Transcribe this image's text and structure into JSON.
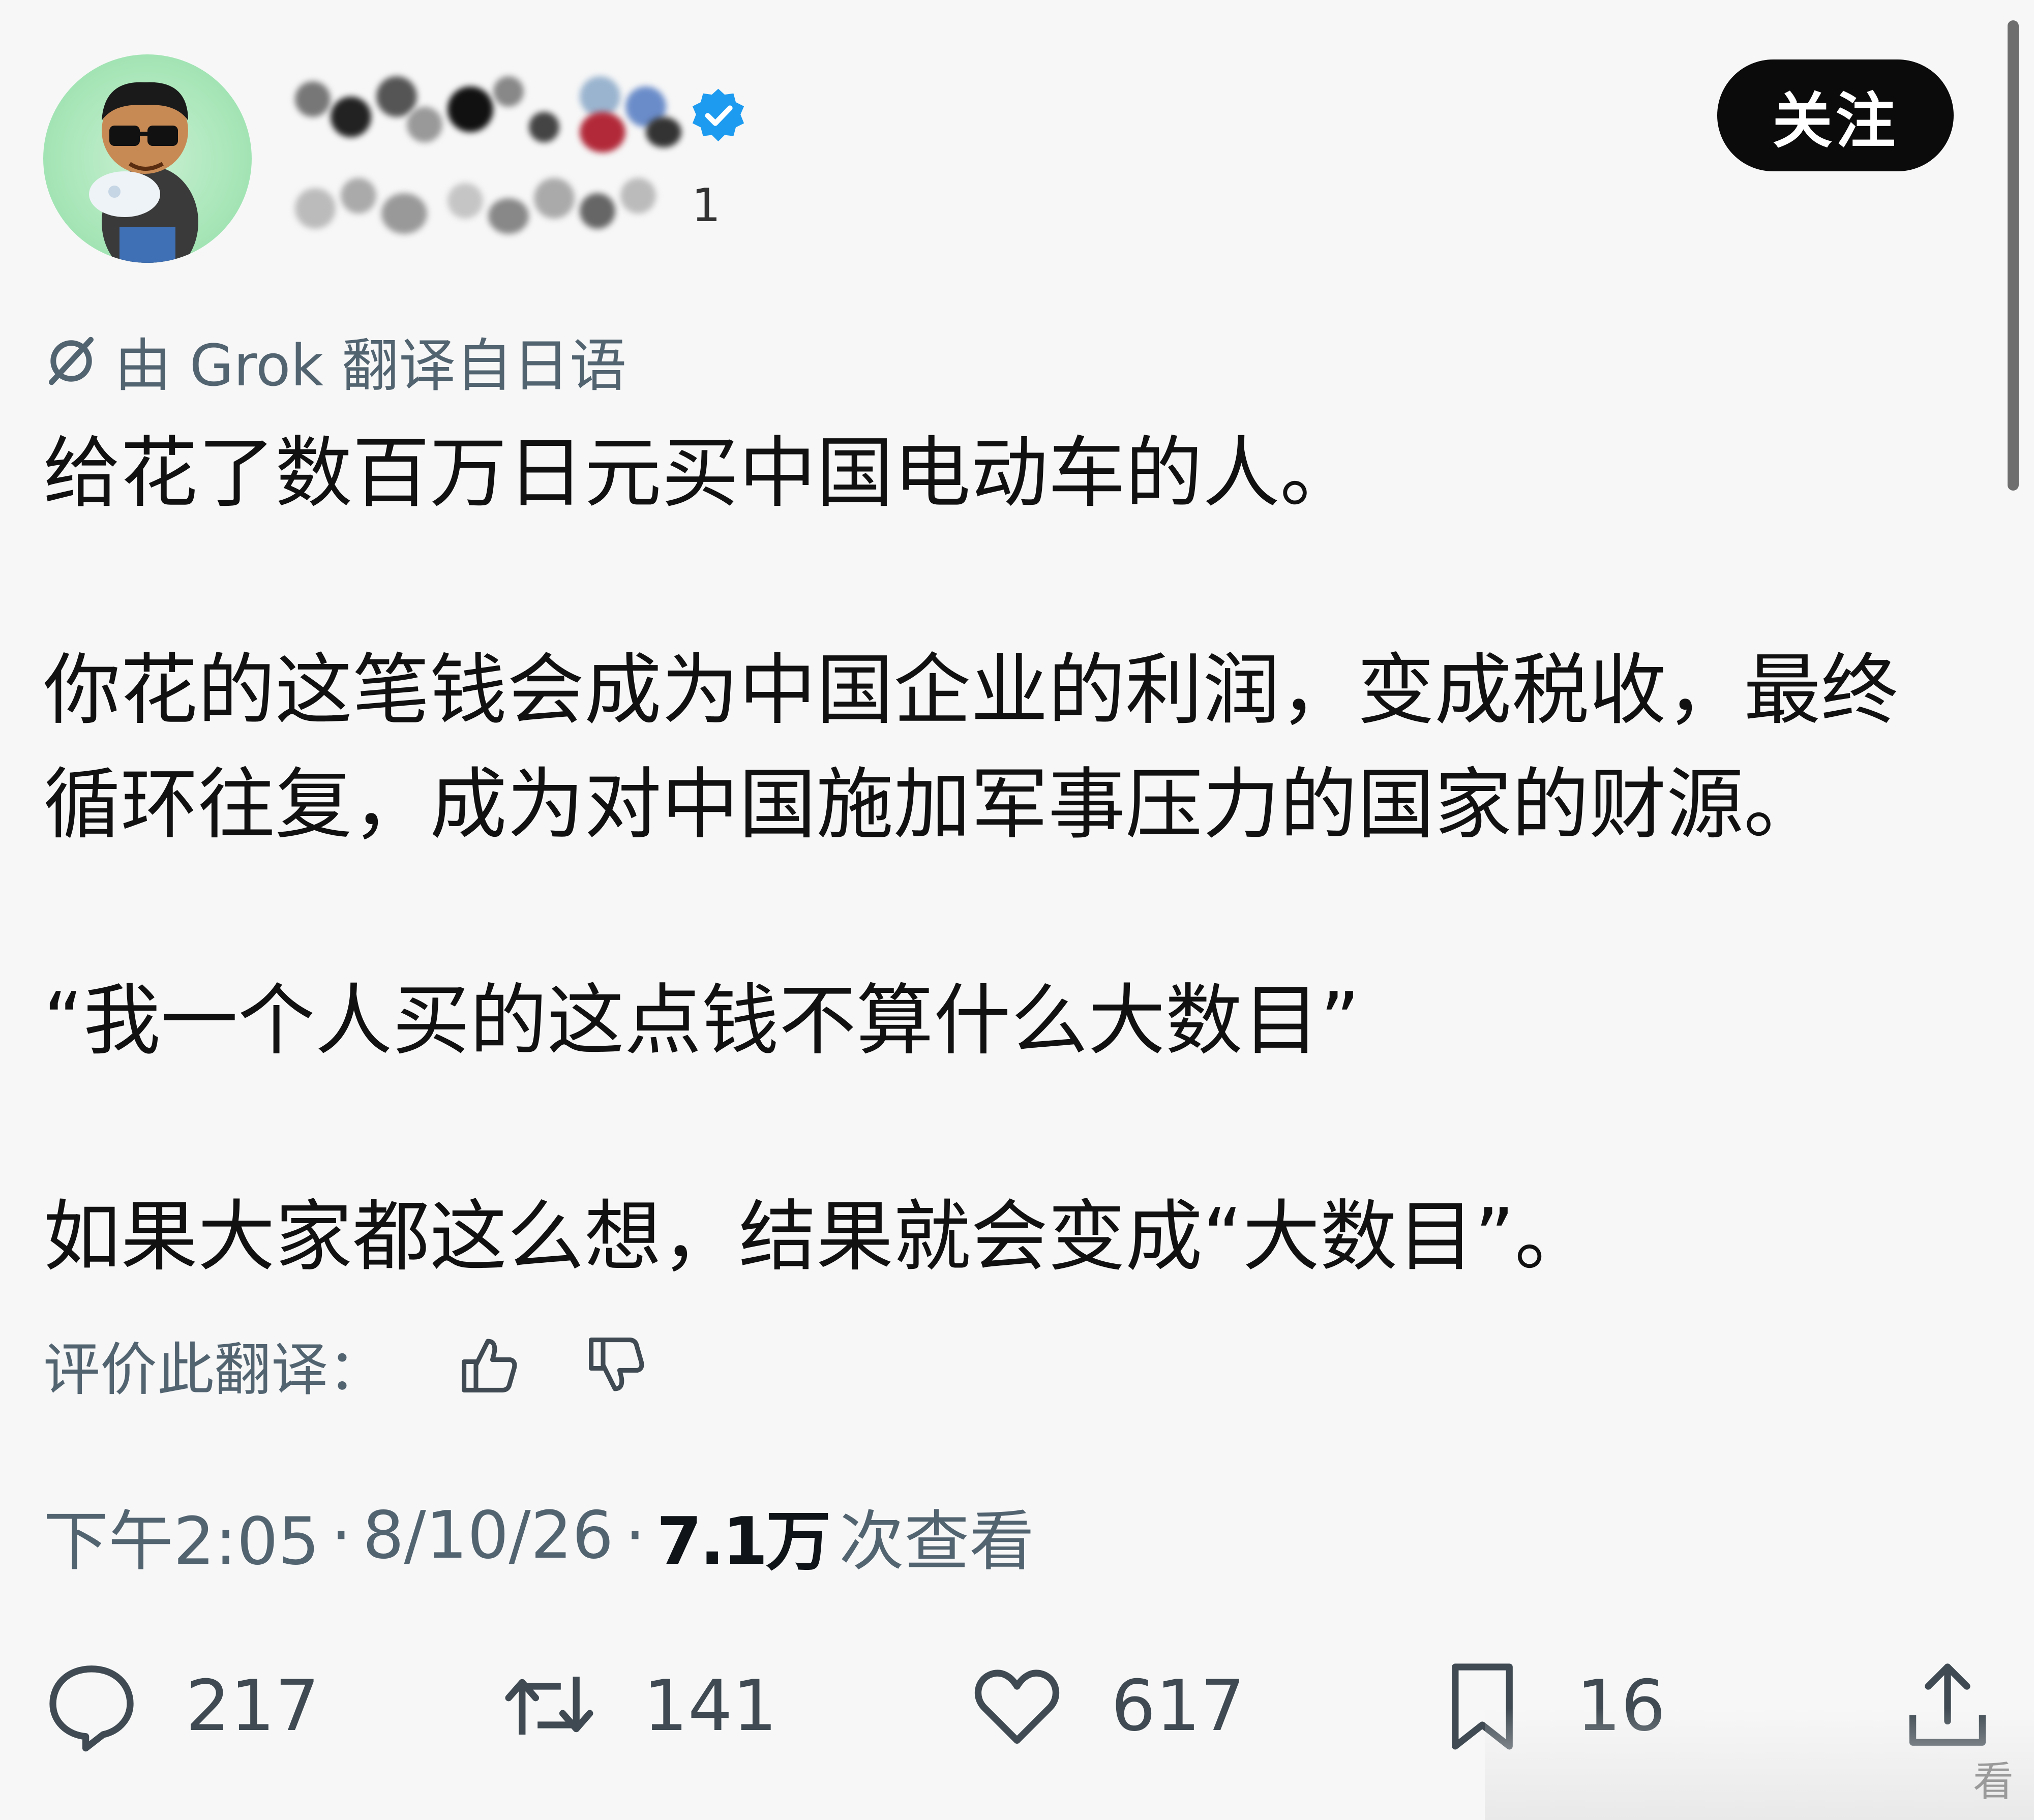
{
  "header": {
    "follow_label": "关注",
    "handle_tail": "1",
    "verified_color": "#1d9bf0"
  },
  "translation": {
    "note": "由 Grok 翻译自日语"
  },
  "post": {
    "paragraphs": [
      "给花了数百万日元买中国电动车的人。",
      "你花的这笔钱会成为中国企业的利润，变成税收，最终\n循环往复，成为对中国施加军事压力的国家的财源。",
      "“我一个人买的这点钱不算什么大数目”",
      "如果大家都这么想，结果就会变成“大数目”。"
    ]
  },
  "rating": {
    "label": "评价此翻译："
  },
  "meta": {
    "time": "下午2:05",
    "date": "8/10/26",
    "views_count": "7.1万",
    "views_label": "次查看",
    "separator": "·"
  },
  "actions": {
    "reply_count": "217",
    "retweet_count": "141",
    "like_count": "617",
    "bookmark_count": "16"
  },
  "watermark": "看"
}
